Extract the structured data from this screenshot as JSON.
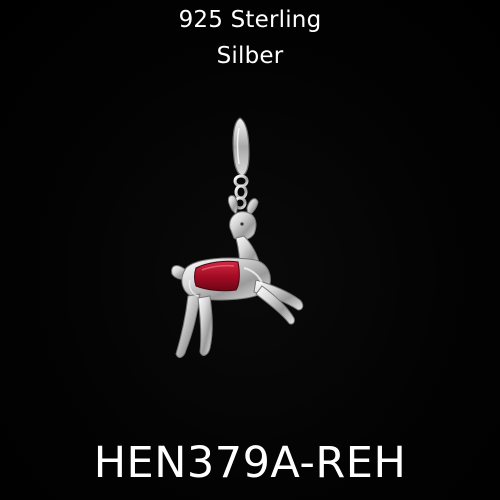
{
  "caption": {
    "material_line1": "925 Sterling",
    "material_line2": "Silber"
  },
  "product": {
    "code": "HEN379A-REH"
  },
  "image": {
    "subject_icon": "deer-charm-icon",
    "colors": {
      "background": "#000000",
      "silver": "#d9d9d9",
      "enamel": "#b0102a",
      "text": "#ffffff"
    }
  }
}
